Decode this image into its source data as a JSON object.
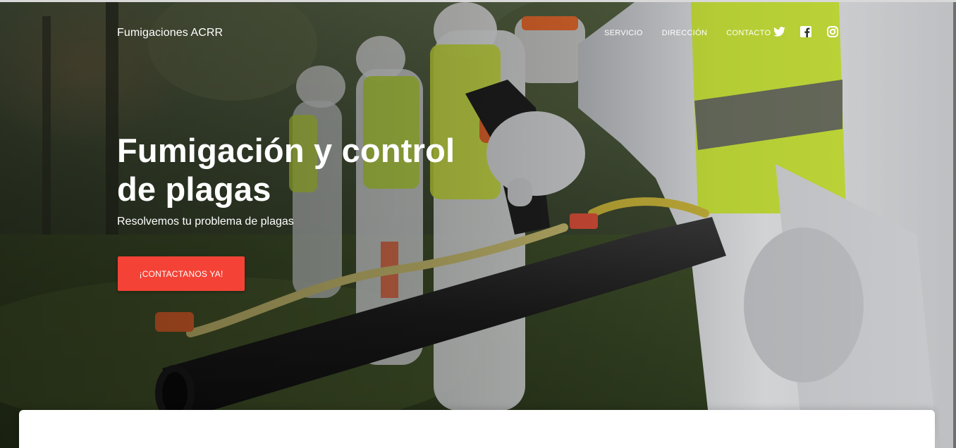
{
  "navbar": {
    "brand": "Fumigaciones ACRR",
    "links": [
      {
        "label": "SERVICIO"
      },
      {
        "label": "DIRECCIÓN"
      },
      {
        "label": "CONTACTO"
      }
    ],
    "social_icons": [
      "twitter-icon",
      "facebook-icon",
      "instagram-icon"
    ]
  },
  "hero": {
    "title_line1": "Fumigación y control",
    "title_line2": "de plagas",
    "subtitle": "Resolvemos tu problema de plagas",
    "cta_label": "¡CONTACTANOS YA!"
  },
  "colors": {
    "accent": "#f44336",
    "text_on_hero": "#ffffff",
    "card_background": "#ffffff"
  }
}
